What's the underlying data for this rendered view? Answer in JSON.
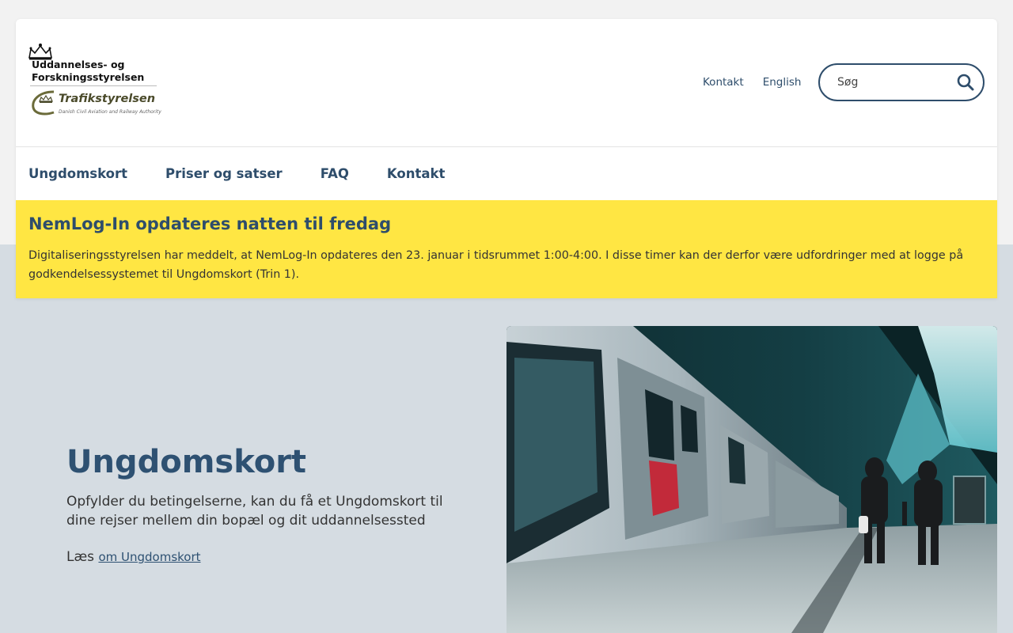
{
  "logo": {
    "ufs_line1": "Uddannelses- og",
    "ufs_line2": "Forskningsstyrelsen",
    "tfs_name": "Trafikstyrelsen",
    "tfs_subtitle": "Danish Civil Aviation and Railway Authority"
  },
  "utility_nav": {
    "contact": "Kontakt",
    "english": "English"
  },
  "search": {
    "placeholder": "Søg"
  },
  "main_nav": [
    {
      "label": "Ungdomskort"
    },
    {
      "label": "Priser og satser"
    },
    {
      "label": "FAQ"
    },
    {
      "label": "Kontakt"
    }
  ],
  "alert": {
    "title": "NemLog-In opdateres natten til fredag",
    "body": "Digitaliseringsstyrelsen har meddelt, at NemLog-In opdateres den 23. januar i tidsrummet 1:00-4:00. I disse timer kan der derfor være udfordringer med at logge på godkendelsessystemet til Ungdomskort (Trin 1)."
  },
  "hero": {
    "title": "Ungdomskort",
    "lead": "Opfylder du betingelserne, kan du få et Ungdomskort til dine rejser mellem din bopæl og dit uddannelsessted",
    "read_prefix": "Læs",
    "read_link": "om Ungdomskort",
    "image_icon": "train-station-photo"
  },
  "colors": {
    "brand_blue": "#2e4d6b",
    "alert_yellow": "#ffe643",
    "page_bg": "#d5dce2"
  }
}
